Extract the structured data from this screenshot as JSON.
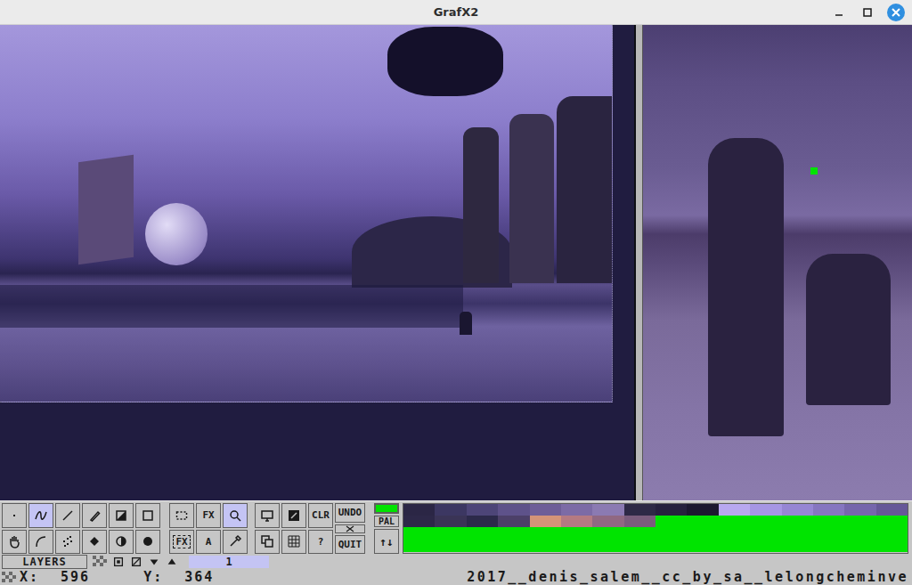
{
  "window": {
    "title": "GrafX2"
  },
  "toolbar": {
    "groups": [
      [
        [
          {
            "kind": "icon",
            "selected": false
          },
          {
            "kind": "icon",
            "selected": false
          }
        ],
        [
          {
            "kind": "icon",
            "selected": true
          },
          {
            "kind": "icon",
            "selected": false
          }
        ],
        [
          {
            "kind": "icon",
            "selected": false
          },
          {
            "kind": "icon",
            "selected": false
          }
        ],
        [
          {
            "kind": "icon",
            "selected": false
          },
          {
            "kind": "icon",
            "selected": false
          }
        ],
        [
          {
            "kind": "icon",
            "selected": false
          },
          {
            "kind": "icon",
            "selected": false
          }
        ],
        [
          {
            "kind": "icon",
            "selected": false
          },
          {
            "kind": "icon",
            "selected": false
          }
        ]
      ],
      [
        [
          {
            "kind": "icon",
            "selected": false
          },
          {
            "kind": "boxed",
            "label": "FX",
            "selected": false
          }
        ],
        [
          {
            "kind": "text",
            "label": "FX",
            "selected": false
          },
          {
            "kind": "text",
            "label": "A",
            "selected": false
          }
        ],
        [
          {
            "kind": "icon",
            "selected": true
          },
          {
            "kind": "icon",
            "selected": false
          }
        ]
      ],
      [
        [
          {
            "kind": "icon",
            "selected": false
          },
          {
            "kind": "icon",
            "selected": false
          }
        ],
        [
          {
            "kind": "icon",
            "selected": false
          },
          {
            "kind": "icon",
            "selected": false
          }
        ],
        [
          {
            "kind": "text",
            "label": "CLR",
            "selected": false
          },
          {
            "kind": "text",
            "label": "?",
            "selected": false
          }
        ],
        [
          {
            "kind": "text",
            "label": "UNDO",
            "selected": false
          },
          {
            "kind": "icon",
            "selected": false
          },
          {
            "kind": "text",
            "label": "QUIT",
            "selected": false
          }
        ]
      ]
    ],
    "fore_color": "#00e400",
    "pal_label": "PAL",
    "swap_label": "↑↓"
  },
  "palette": {
    "rows": [
      [
        "#2b2645",
        "#3c3762",
        "#4d4578",
        "#5e528a",
        "#6e5e98",
        "#7c6ba6",
        "#8b7ab2",
        "#2e2946",
        "#26213e",
        "#1c1830",
        "#b8a8f0",
        "#a696e4",
        "#9686d4",
        "#8676c0",
        "#7666ac",
        "#665898"
      ],
      [
        "#2d2848",
        "#3a3456",
        "#2c2a4a",
        "#4c4068",
        "#d49478",
        "#b47a82",
        "#906882",
        "#7a5c7c",
        "#00e400",
        "#00e400",
        "#00e400",
        "#00e400",
        "#00e400",
        "#00e400",
        "#00e400",
        "#00e400"
      ]
    ],
    "rest": "#00e400"
  },
  "layers": {
    "label": "LAYERS",
    "items": [
      {
        "label": "1",
        "selected": true
      }
    ]
  },
  "status_bar": {
    "x_label": "X:",
    "x": "596",
    "y_label": "Y:",
    "y": "364",
    "filename": "2017__denis_salem__cc_by_sa__lelongcheminve"
  }
}
